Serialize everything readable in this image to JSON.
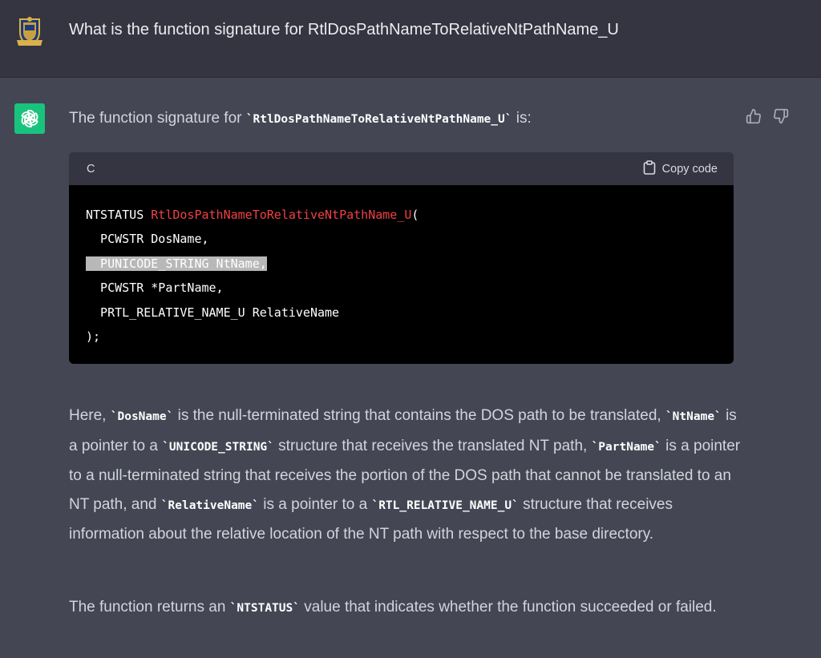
{
  "user": {
    "question": "What is the function signature for RtlDosPathNameToRelativeNtPathName_U"
  },
  "answer": {
    "intro_prefix": "The function signature for ",
    "intro_code": "`RtlDosPathNameToRelativeNtPathName_U`",
    "intro_suffix": " is:",
    "code": {
      "language": "C",
      "copy_label": "Copy code",
      "line1_type": "NTSTATUS ",
      "line1_fn": "RtlDosPathNameToRelativeNtPathName_U",
      "line1_paren": "(",
      "line2": "  PCWSTR DosName,",
      "line3": "  PUNICODE_STRING NtName,",
      "line4": "  PCWSTR *PartName,",
      "line5": "  PRTL_RELATIVE_NAME_U RelativeName",
      "line6": ");"
    },
    "p1": {
      "t1": "Here, ",
      "c1": "`DosName`",
      "t2": " is the null-terminated string that contains the DOS path to be translated, ",
      "c2": "`NtName`",
      "t3": " is a pointer to a ",
      "c3": "`UNICODE_STRING`",
      "t4": " structure that receives the translated NT path, ",
      "c4": "`PartName`",
      "t5": " is a pointer to a null-terminated string that receives the portion of the DOS path that cannot be translated to an NT path, and ",
      "c5": "`RelativeName`",
      "t6": " is a pointer to a ",
      "c6": "`RTL_RELATIVE_NAME_U`",
      "t7": " structure that receives information about the relative location of the NT path with respect to the base directory."
    },
    "p2": {
      "t1": "The function returns an ",
      "c1": "`NTSTATUS`",
      "t2": " value that indicates whether the function succeeded or failed."
    }
  },
  "colors": {
    "user_bg": "#343541",
    "assistant_bg": "#444654",
    "gpt_green": "#19c37d",
    "code_fn": "#ef4146"
  },
  "icons": {
    "user_avatar": "crest-avatar-icon",
    "assistant_avatar": "openai-logo-icon",
    "copy": "clipboard-icon",
    "like": "thumbs-up-icon",
    "dislike": "thumbs-down-icon"
  }
}
